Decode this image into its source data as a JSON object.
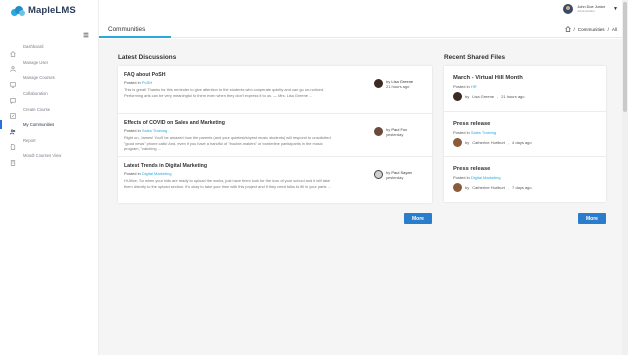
{
  "app": {
    "name": "MapleLMS"
  },
  "colors": {
    "accent": "#29a9e0",
    "button": "#2a7ccd",
    "active_indicator": "#2a6fdb"
  },
  "user": {
    "name": "John Doe Junior",
    "role": "Administrator"
  },
  "sidebar": {
    "items": [
      {
        "label": "Dashboard",
        "icon": "home-icon",
        "active": false
      },
      {
        "label": "Manage User",
        "icon": "user-icon",
        "active": false
      },
      {
        "label": "Manage Courses",
        "icon": "monitor-icon",
        "active": false
      },
      {
        "label": "Collaboration",
        "icon": "chat-icon",
        "active": false
      },
      {
        "label": "Create Course",
        "icon": "edit-icon",
        "active": false
      },
      {
        "label": "My Communities",
        "icon": "community-icon",
        "active": true
      },
      {
        "label": "Report",
        "icon": "document-icon",
        "active": false
      },
      {
        "label": "Moodl Courses View",
        "icon": "course-view-icon",
        "active": false
      }
    ]
  },
  "header": {
    "title": "Communities",
    "breadcrumb": [
      "Communities",
      "All"
    ]
  },
  "discussions": {
    "title": "Latest Discussions",
    "items": [
      {
        "title": "FAQ about PoSH",
        "posted_prefix": "Posted in",
        "category": "PoSH",
        "body": "This is great! Thanks for this reminder to give attention to the students who cooperate quietly and can go un-noticed. Performing arts can be very meaningful to them even when they don't express it to us. — Mrs. Lisa Greene ...",
        "by_prefix": "by",
        "author": "Lisa Greene",
        "time": "21 hours ago"
      },
      {
        "title": "Effects of COVID on Sales and Marketing",
        "posted_prefix": "Posted in",
        "category": "Sales Training",
        "body": "Right on, James! You'll be amazed how the parents (and your quietest/shyest music students) will respond to unsolicited \"good news\" phone calls! And, even if you have a handful of \"trouble-makers\" or borderline participants in the music program, \"catching ...",
        "by_prefix": "by",
        "author": "Paul Fox",
        "time": "yesterday"
      },
      {
        "title": "Latest Trends in Digital Marketing",
        "posted_prefix": "Posted in",
        "category": "Digital Marketing",
        "body": "Hi Alice, So when your kids are ready to upload the works, just have them look for the icon of your school and it will take them directly to the upload section. It's okay to take your time with this project and if they need folks to fill in your parts ...",
        "by_prefix": "by",
        "author": "Paul Sayan",
        "time": "yesterday"
      }
    ],
    "more_label": "More"
  },
  "files": {
    "title": "Recent Shared Files",
    "items": [
      {
        "title": "March - Virtual Hill Month",
        "posted_prefix": "Posted in",
        "category": "HR",
        "by_prefix": "by",
        "author": "Lisa Greene",
        "time": "21 hours ago"
      },
      {
        "title": "Press release",
        "posted_prefix": "Posted in",
        "category": "Sales Training",
        "by_prefix": "by",
        "author": "Catherine Hurlburt",
        "time": "4 days ago"
      },
      {
        "title": "Press release",
        "posted_prefix": "Posted in",
        "category": "Digital Marketing",
        "by_prefix": "by",
        "author": "Catherine Hurlburt",
        "time": "7 days ago"
      }
    ],
    "more_label": "More"
  }
}
